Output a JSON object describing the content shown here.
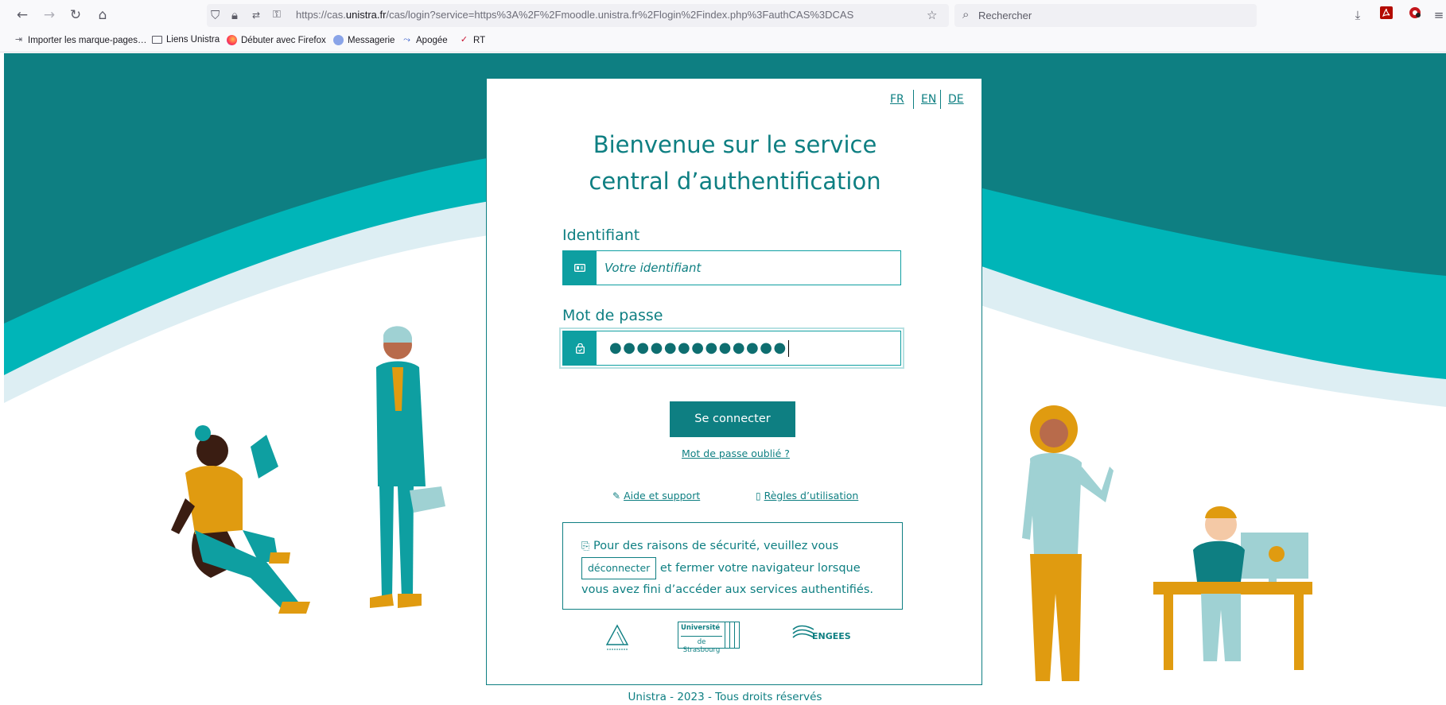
{
  "browser": {
    "url_prefix": "https://cas.",
    "url_domain": "unistra.fr",
    "url_rest": "/cas/login?service=https%3A%2F%2Fmoodle.unistra.fr%2Flogin%2Findex.php%3FauthCAS%3DCAS",
    "search_placeholder": "Rechercher",
    "bookmarks": [
      {
        "label": "Importer les marque-pages…",
        "icon": "import-icon"
      },
      {
        "label": "Liens Unistra",
        "icon": "folder-icon"
      },
      {
        "label": "Débuter avec Firefox",
        "icon": "firefox-icon"
      },
      {
        "label": "Messagerie",
        "icon": "mail-icon"
      },
      {
        "label": "Apogée",
        "icon": "apogee-icon"
      },
      {
        "label": "RT",
        "icon": "rt-icon"
      }
    ]
  },
  "languages": [
    "FR",
    "EN",
    "DE"
  ],
  "title_line1": "Bienvenue sur le service",
  "title_line2": "central d’authentification",
  "login": {
    "username_label": "Identifiant",
    "username_placeholder": "Votre identifiant",
    "password_label": "Mot de passe",
    "password_masked": "●●●●●●●●●●●●●",
    "submit_label": "Se connecter",
    "forgot_label": "Mot de passe oublié ?"
  },
  "help_label": "Aide et support",
  "rules_label": "Règles d’utilisation",
  "notice": {
    "text_before": "Pour des raisons de sécurité, veuillez vous",
    "logout_label": "déconnecter",
    "text_after": "et fermer votre navigateur lorsque vous avez fini d’accéder aux services authentifiés."
  },
  "logos": {
    "unistra_line1": "Université",
    "unistra_line2": "de Strasbourg",
    "engees": "ENGEES"
  },
  "footer": "Unistra - 2023 - Tous droits réservés",
  "colors": {
    "primary": "#0e7f82",
    "accent": "#0e9fa1",
    "wave_dark": "#0e7f82",
    "wave_mid": "#00b5b8",
    "wave_light": "#ddeef3",
    "mustard": "#e09b10"
  }
}
